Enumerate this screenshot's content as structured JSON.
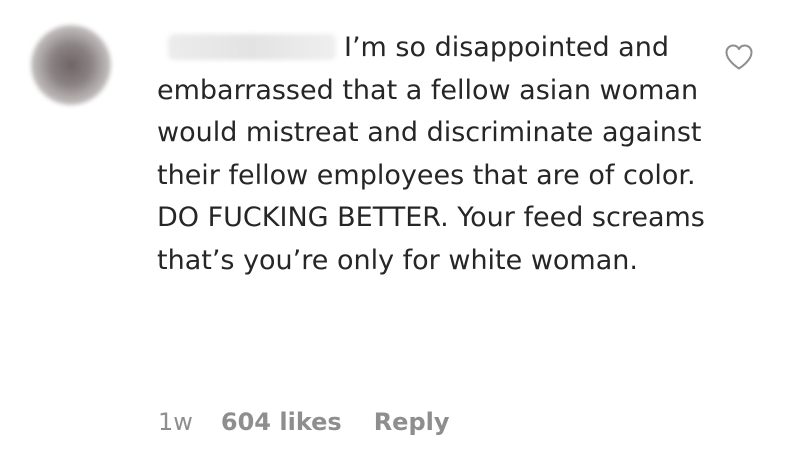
{
  "comment": {
    "text": "I’m so disappointed and embarrassed that a fellow asian woman would mistreat and discriminate against their fellow employees that are of color. DO FUCKING BETTER. Your feed screams that’s you’re only for white woman.",
    "time": "1w",
    "likes": "604 likes",
    "reply_label": "Reply",
    "like_icon": "heart-outline-icon"
  },
  "colors": {
    "text": "#262626",
    "meta": "#8e8e8e",
    "icon": "#8e8e8e"
  }
}
